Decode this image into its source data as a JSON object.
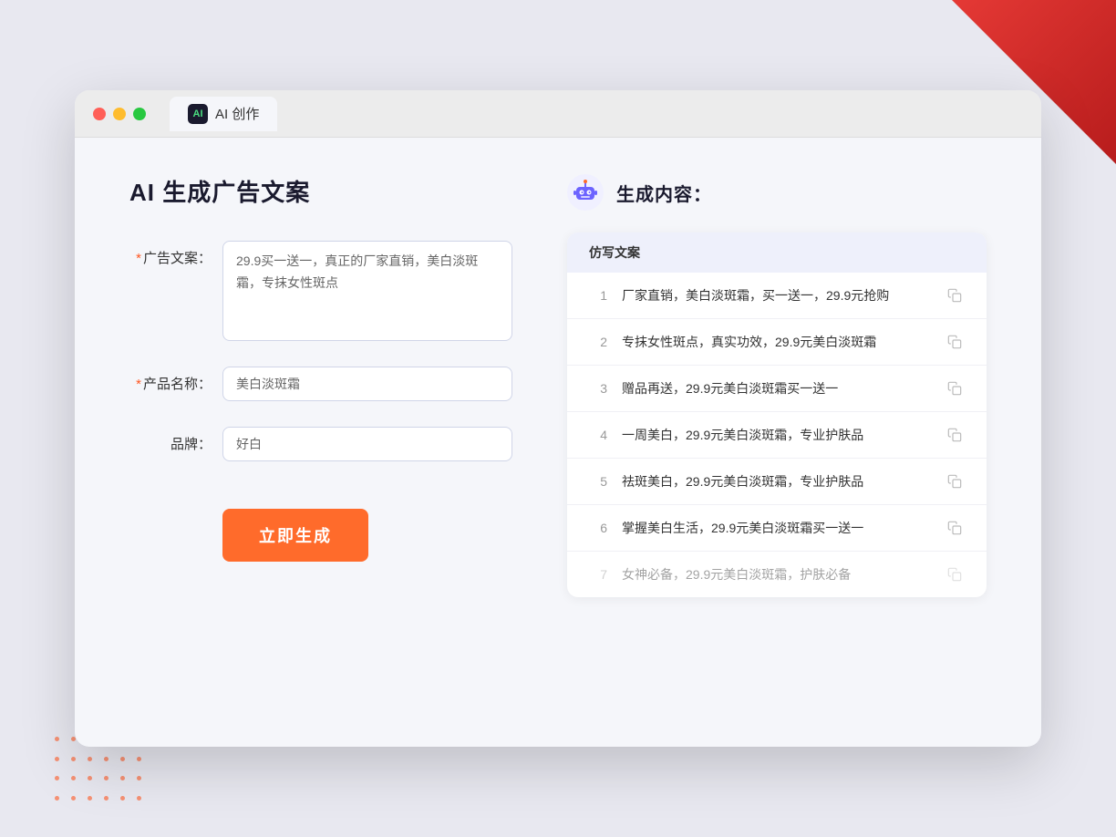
{
  "window": {
    "tab_label": "AI 创作"
  },
  "header": {
    "page_title": "AI 生成广告文案",
    "results_title": "生成内容："
  },
  "form": {
    "ad_copy_label": "广告文案：",
    "ad_copy_required": "*",
    "ad_copy_value": "29.9买一送一，真正的厂家直销，美白淡斑霜，专抹女性斑点",
    "product_name_label": "产品名称：",
    "product_name_required": "*",
    "product_name_value": "美白淡斑霜",
    "brand_label": "品牌：",
    "brand_value": "好白",
    "generate_button": "立即生成"
  },
  "results": {
    "column_header": "仿写文案",
    "items": [
      {
        "num": "1",
        "text": "厂家直销，美白淡斑霜，买一送一，29.9元抢购",
        "faded": false
      },
      {
        "num": "2",
        "text": "专抹女性斑点，真实功效，29.9元美白淡斑霜",
        "faded": false
      },
      {
        "num": "3",
        "text": "赠品再送，29.9元美白淡斑霜买一送一",
        "faded": false
      },
      {
        "num": "4",
        "text": "一周美白，29.9元美白淡斑霜，专业护肤品",
        "faded": false
      },
      {
        "num": "5",
        "text": "祛斑美白，29.9元美白淡斑霜，专业护肤品",
        "faded": false
      },
      {
        "num": "6",
        "text": "掌握美白生活，29.9元美白淡斑霜买一送一",
        "faded": false
      },
      {
        "num": "7",
        "text": "女神必备，29.9元美白淡斑霜，护肤必备",
        "faded": true
      }
    ]
  },
  "colors": {
    "accent": "#ff6b2b",
    "brand_purple": "#6c63ff",
    "required_star": "#ff5722"
  }
}
